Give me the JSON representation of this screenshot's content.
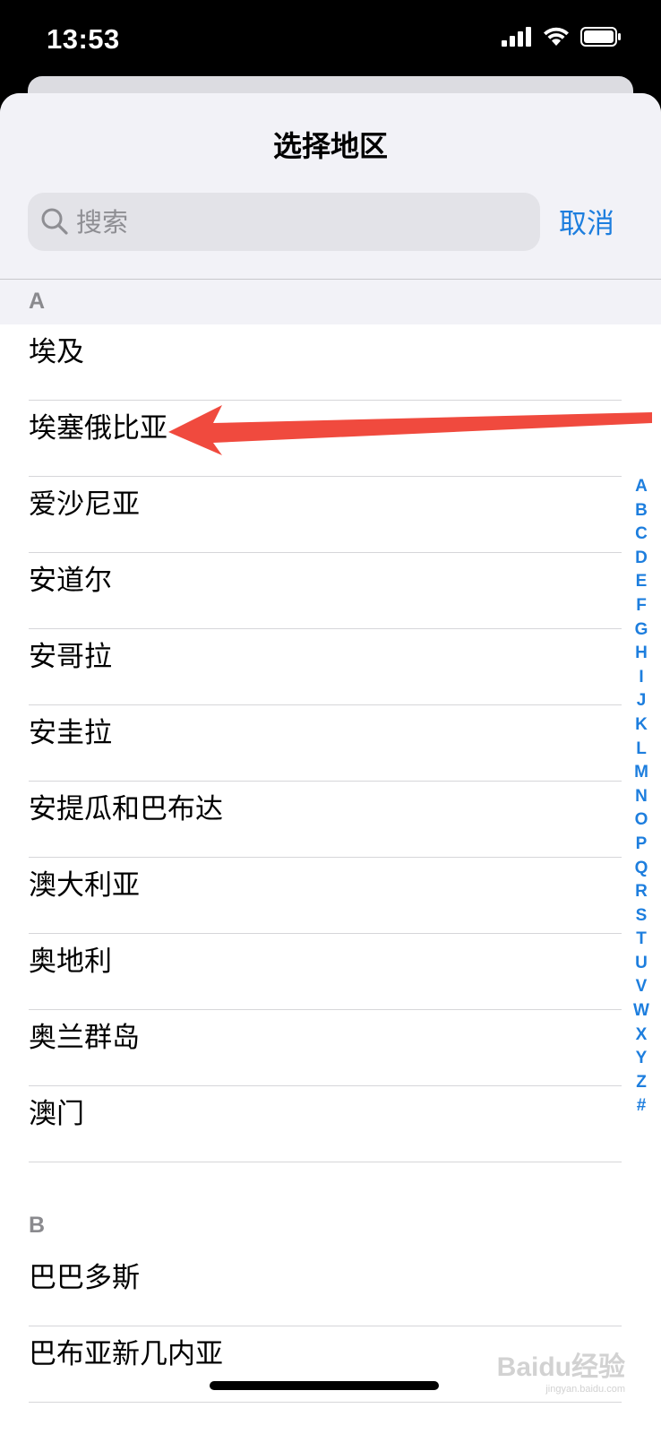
{
  "status": {
    "time": "13:53"
  },
  "sheet": {
    "title": "选择地区",
    "search": {
      "placeholder": "搜索",
      "value": ""
    },
    "cancel_label": "取消"
  },
  "sections": [
    {
      "letter": "A",
      "items": [
        "埃及",
        "埃塞俄比亚",
        "爱沙尼亚",
        "安道尔",
        "安哥拉",
        "安圭拉",
        "安提瓜和巴布达",
        "澳大利亚",
        "奥地利",
        "奥兰群岛",
        "澳门"
      ]
    },
    {
      "letter": "B",
      "items": [
        "巴巴多斯",
        "巴布亚新几内亚"
      ]
    }
  ],
  "index_letters": [
    "A",
    "B",
    "C",
    "D",
    "E",
    "F",
    "G",
    "H",
    "I",
    "J",
    "K",
    "L",
    "M",
    "N",
    "O",
    "P",
    "Q",
    "R",
    "S",
    "T",
    "U",
    "V",
    "W",
    "X",
    "Y",
    "Z",
    "#"
  ],
  "annotation": {
    "color": "#f04a3e",
    "points_to": "埃塞俄比亚"
  },
  "watermark": {
    "text": "Baidu经验",
    "url": "jingyan.baidu.com"
  },
  "colors": {
    "accent": "#1d7ede",
    "header_bg": "#f2f2f7",
    "search_bg": "#e3e3e8"
  }
}
